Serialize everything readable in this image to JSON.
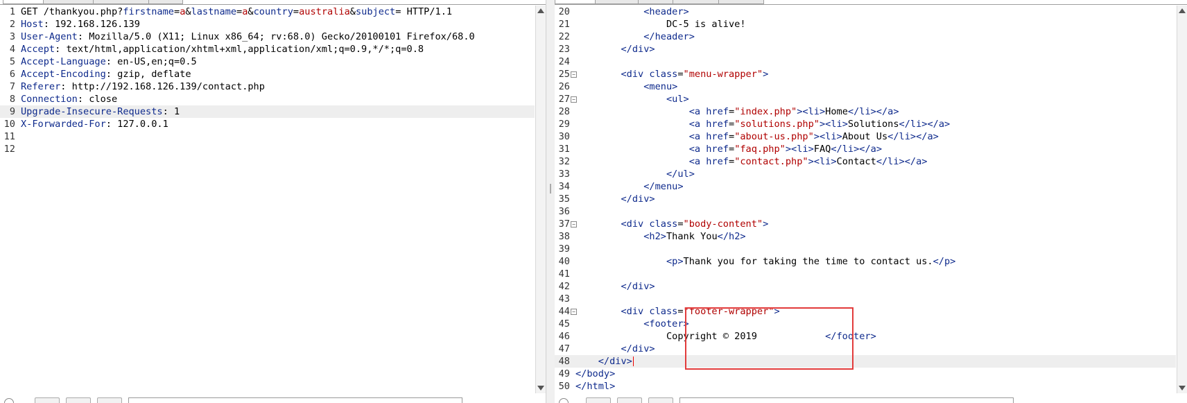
{
  "request": {
    "lines": [
      {
        "n": "1",
        "segments": [
          {
            "t": "GET /thankyou.php?",
            "c": "c-val"
          },
          {
            "t": "firstname",
            "c": "c-pn"
          },
          {
            "t": "=",
            "c": "c-val"
          },
          {
            "t": "a",
            "c": "c-pv"
          },
          {
            "t": "&",
            "c": "c-val"
          },
          {
            "t": "lastname",
            "c": "c-pn"
          },
          {
            "t": "=",
            "c": "c-val"
          },
          {
            "t": "a",
            "c": "c-pv"
          },
          {
            "t": "&",
            "c": "c-val"
          },
          {
            "t": "country",
            "c": "c-pn"
          },
          {
            "t": "=",
            "c": "c-val"
          },
          {
            "t": "australia",
            "c": "c-pv"
          },
          {
            "t": "&",
            "c": "c-val"
          },
          {
            "t": "subject",
            "c": "c-pn"
          },
          {
            "t": "= HTTP/1.1",
            "c": "c-val"
          }
        ]
      },
      {
        "n": "2",
        "segments": [
          {
            "t": "Host",
            "c": "c-key"
          },
          {
            "t": ": 192.168.126.139",
            "c": "c-val"
          }
        ]
      },
      {
        "n": "3",
        "segments": [
          {
            "t": "User-Agent",
            "c": "c-key"
          },
          {
            "t": ": Mozilla/5.0 (X11; Linux x86_64; rv:68.0) Gecko/20100101 Firefox/68.0",
            "c": "c-val"
          }
        ]
      },
      {
        "n": "4",
        "segments": [
          {
            "t": "Accept",
            "c": "c-key"
          },
          {
            "t": ": text/html,application/xhtml+xml,application/xml;q=0.9,*/*;q=0.8",
            "c": "c-val"
          }
        ]
      },
      {
        "n": "5",
        "segments": [
          {
            "t": "Accept-Language",
            "c": "c-key"
          },
          {
            "t": ": en-US,en;q=0.5",
            "c": "c-val"
          }
        ]
      },
      {
        "n": "6",
        "segments": [
          {
            "t": "Accept-Encoding",
            "c": "c-key"
          },
          {
            "t": ": gzip, deflate",
            "c": "c-val"
          }
        ]
      },
      {
        "n": "7",
        "segments": [
          {
            "t": "Referer",
            "c": "c-key"
          },
          {
            "t": ": http://192.168.126.139/contact.php",
            "c": "c-val"
          }
        ]
      },
      {
        "n": "8",
        "segments": [
          {
            "t": "Connection",
            "c": "c-key"
          },
          {
            "t": ": close",
            "c": "c-val"
          }
        ]
      },
      {
        "n": "9",
        "hl": true,
        "segments": [
          {
            "t": "Upgrade-Insecure-Requests",
            "c": "c-key"
          },
          {
            "t": ": 1",
            "c": "c-val"
          }
        ]
      },
      {
        "n": "10",
        "segments": [
          {
            "t": "X-Forwarded-For",
            "c": "c-key"
          },
          {
            "t": ": 127.0.0.1",
            "c": "c-val"
          }
        ]
      },
      {
        "n": "11",
        "segments": []
      },
      {
        "n": "12",
        "segments": []
      }
    ]
  },
  "response": {
    "lines": [
      {
        "n": "20",
        "segments": [
          {
            "t": "            ",
            "c": "c-val"
          },
          {
            "t": "<header>",
            "c": "c-tag"
          }
        ]
      },
      {
        "n": "21",
        "segments": [
          {
            "t": "                DC-5 is alive!",
            "c": "c-val"
          }
        ]
      },
      {
        "n": "22",
        "segments": [
          {
            "t": "            ",
            "c": "c-val"
          },
          {
            "t": "</header>",
            "c": "c-tag"
          }
        ]
      },
      {
        "n": "23",
        "segments": [
          {
            "t": "        ",
            "c": "c-val"
          },
          {
            "t": "</div>",
            "c": "c-tag"
          }
        ]
      },
      {
        "n": "24",
        "segments": []
      },
      {
        "n": "25",
        "fold": true,
        "segments": [
          {
            "t": "        ",
            "c": "c-val"
          },
          {
            "t": "<div ",
            "c": "c-tag"
          },
          {
            "t": "class",
            "c": "c-at"
          },
          {
            "t": "=",
            "c": "c-val"
          },
          {
            "t": "\"menu-wrapper\"",
            "c": "c-av"
          },
          {
            "t": ">",
            "c": "c-tag"
          }
        ]
      },
      {
        "n": "26",
        "segments": [
          {
            "t": "            ",
            "c": "c-val"
          },
          {
            "t": "<menu>",
            "c": "c-tag"
          }
        ]
      },
      {
        "n": "27",
        "fold": true,
        "segments": [
          {
            "t": "                ",
            "c": "c-val"
          },
          {
            "t": "<ul>",
            "c": "c-tag"
          }
        ]
      },
      {
        "n": "28",
        "segments": [
          {
            "t": "                    ",
            "c": "c-val"
          },
          {
            "t": "<a ",
            "c": "c-tag"
          },
          {
            "t": "href",
            "c": "c-at"
          },
          {
            "t": "=",
            "c": "c-val"
          },
          {
            "t": "\"index.php\"",
            "c": "c-av"
          },
          {
            "t": "><li>",
            "c": "c-tag"
          },
          {
            "t": "Home",
            "c": "c-val"
          },
          {
            "t": "</li></a>",
            "c": "c-tag"
          }
        ]
      },
      {
        "n": "29",
        "segments": [
          {
            "t": "                    ",
            "c": "c-val"
          },
          {
            "t": "<a ",
            "c": "c-tag"
          },
          {
            "t": "href",
            "c": "c-at"
          },
          {
            "t": "=",
            "c": "c-val"
          },
          {
            "t": "\"solutions.php\"",
            "c": "c-av"
          },
          {
            "t": "><li>",
            "c": "c-tag"
          },
          {
            "t": "Solutions",
            "c": "c-val"
          },
          {
            "t": "</li></a>",
            "c": "c-tag"
          }
        ]
      },
      {
        "n": "30",
        "segments": [
          {
            "t": "                    ",
            "c": "c-val"
          },
          {
            "t": "<a ",
            "c": "c-tag"
          },
          {
            "t": "href",
            "c": "c-at"
          },
          {
            "t": "=",
            "c": "c-val"
          },
          {
            "t": "\"about-us.php\"",
            "c": "c-av"
          },
          {
            "t": "><li>",
            "c": "c-tag"
          },
          {
            "t": "About Us",
            "c": "c-val"
          },
          {
            "t": "</li></a>",
            "c": "c-tag"
          }
        ]
      },
      {
        "n": "31",
        "segments": [
          {
            "t": "                    ",
            "c": "c-val"
          },
          {
            "t": "<a ",
            "c": "c-tag"
          },
          {
            "t": "href",
            "c": "c-at"
          },
          {
            "t": "=",
            "c": "c-val"
          },
          {
            "t": "\"faq.php\"",
            "c": "c-av"
          },
          {
            "t": "><li>",
            "c": "c-tag"
          },
          {
            "t": "FAQ",
            "c": "c-val"
          },
          {
            "t": "</li></a>",
            "c": "c-tag"
          }
        ]
      },
      {
        "n": "32",
        "segments": [
          {
            "t": "                    ",
            "c": "c-val"
          },
          {
            "t": "<a ",
            "c": "c-tag"
          },
          {
            "t": "href",
            "c": "c-at"
          },
          {
            "t": "=",
            "c": "c-val"
          },
          {
            "t": "\"contact.php\"",
            "c": "c-av"
          },
          {
            "t": "><li>",
            "c": "c-tag"
          },
          {
            "t": "Contact",
            "c": "c-val"
          },
          {
            "t": "</li></a>",
            "c": "c-tag"
          }
        ]
      },
      {
        "n": "33",
        "segments": [
          {
            "t": "                ",
            "c": "c-val"
          },
          {
            "t": "</ul>",
            "c": "c-tag"
          }
        ]
      },
      {
        "n": "34",
        "segments": [
          {
            "t": "            ",
            "c": "c-val"
          },
          {
            "t": "</menu>",
            "c": "c-tag"
          }
        ]
      },
      {
        "n": "35",
        "segments": [
          {
            "t": "        ",
            "c": "c-val"
          },
          {
            "t": "</div>",
            "c": "c-tag"
          }
        ]
      },
      {
        "n": "36",
        "segments": []
      },
      {
        "n": "37",
        "fold": true,
        "segments": [
          {
            "t": "        ",
            "c": "c-val"
          },
          {
            "t": "<div ",
            "c": "c-tag"
          },
          {
            "t": "class",
            "c": "c-at"
          },
          {
            "t": "=",
            "c": "c-val"
          },
          {
            "t": "\"body-content\"",
            "c": "c-av"
          },
          {
            "t": ">",
            "c": "c-tag"
          }
        ]
      },
      {
        "n": "38",
        "segments": [
          {
            "t": "            ",
            "c": "c-val"
          },
          {
            "t": "<h2>",
            "c": "c-tag"
          },
          {
            "t": "Thank You",
            "c": "c-val"
          },
          {
            "t": "</h2>",
            "c": "c-tag"
          }
        ]
      },
      {
        "n": "39",
        "segments": []
      },
      {
        "n": "40",
        "segments": [
          {
            "t": "                ",
            "c": "c-val"
          },
          {
            "t": "<p>",
            "c": "c-tag"
          },
          {
            "t": "Thank you for taking the time to contact us.",
            "c": "c-val"
          },
          {
            "t": "</p>",
            "c": "c-tag"
          }
        ]
      },
      {
        "n": "41",
        "segments": []
      },
      {
        "n": "42",
        "segments": [
          {
            "t": "        ",
            "c": "c-val"
          },
          {
            "t": "</div>",
            "c": "c-tag"
          }
        ]
      },
      {
        "n": "43",
        "segments": []
      },
      {
        "n": "44",
        "fold": true,
        "segments": [
          {
            "t": "        ",
            "c": "c-val"
          },
          {
            "t": "<div ",
            "c": "c-tag"
          },
          {
            "t": "class",
            "c": "c-at"
          },
          {
            "t": "=",
            "c": "c-val"
          },
          {
            "t": "\"footer-wrapper\"",
            "c": "c-av"
          },
          {
            "t": ">",
            "c": "c-tag"
          }
        ]
      },
      {
        "n": "45",
        "segments": [
          {
            "t": "            ",
            "c": "c-val"
          },
          {
            "t": "<footer>",
            "c": "c-tag"
          }
        ]
      },
      {
        "n": "46",
        "segments": [
          {
            "t": "                Copyright © 2019            ",
            "c": "c-val"
          },
          {
            "t": "</footer>",
            "c": "c-tag"
          }
        ]
      },
      {
        "n": "47",
        "segments": [
          {
            "t": "        ",
            "c": "c-val"
          },
          {
            "t": "</div>",
            "c": "c-tag"
          }
        ]
      },
      {
        "n": "48",
        "hl": true,
        "caret": true,
        "segments": [
          {
            "t": "    ",
            "c": "c-val"
          },
          {
            "t": "</div>",
            "c": "c-tag"
          }
        ]
      },
      {
        "n": "49",
        "segments": [
          {
            "t": "</body>",
            "c": "c-tag"
          }
        ]
      },
      {
        "n": "50",
        "segments": [
          {
            "t": "</html>",
            "c": "c-tag"
          }
        ]
      }
    ]
  },
  "colors": {
    "tag": "#0e2a8c",
    "attr_value": "#b00000",
    "highlight_box": "#e23b3b",
    "current_line": "#eeeeee"
  }
}
